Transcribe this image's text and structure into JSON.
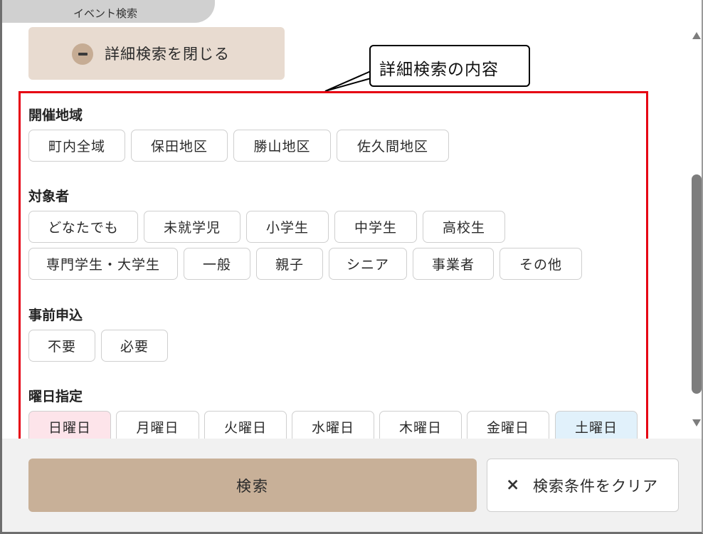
{
  "tab": {
    "label": "イベント検索"
  },
  "toggle": {
    "label": "詳細検索を閉じる",
    "icon": "minus-circle-icon"
  },
  "callout": {
    "text": "詳細検索の内容"
  },
  "sections": {
    "area": {
      "title": "開催地域",
      "options": [
        "町内全域",
        "保田地区",
        "勝山地区",
        "佐久間地区"
      ]
    },
    "target": {
      "title": "対象者",
      "options": [
        "どなたでも",
        "未就学児",
        "小学生",
        "中学生",
        "高校生",
        "専門学生・大学生",
        "一般",
        "親子",
        "シニア",
        "事業者",
        "その他"
      ]
    },
    "application": {
      "title": "事前申込",
      "options": [
        "不要",
        "必要"
      ]
    },
    "weekday": {
      "title": "曜日指定",
      "options": [
        "日曜日",
        "月曜日",
        "火曜日",
        "水曜日",
        "木曜日",
        "金曜日",
        "土曜日"
      ]
    }
  },
  "footer": {
    "search_label": "検索",
    "clear_label": "検索条件をクリア",
    "clear_icon": "×"
  },
  "colors": {
    "accent": "#c8b098",
    "highlight": "#e60012",
    "sunday": "#fde4ea",
    "saturday": "#e1f1fb"
  }
}
